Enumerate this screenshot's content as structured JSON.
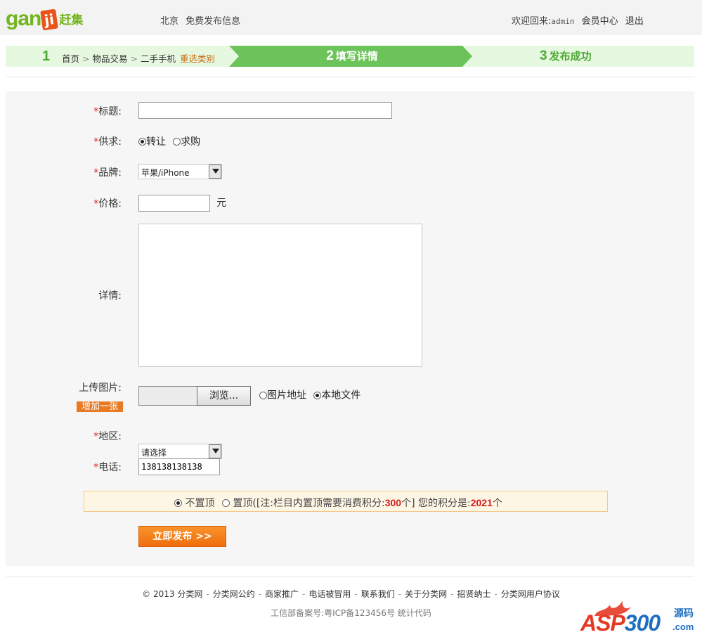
{
  "header": {
    "logo_latin": "gan",
    "logo_mark": "ji",
    "logo_cn": "赶集",
    "city": "北京",
    "post_free": "免费发布信息",
    "welcome": "欢迎回来:",
    "username": "admin",
    "member_center": "会员中心",
    "logout": "退出"
  },
  "steps": {
    "step1_num": "1",
    "crumbs": [
      "首页",
      "物品交易",
      "二手手机"
    ],
    "crumb_sep": ">",
    "reselect": "重选类别",
    "step2_num": "2",
    "step2_label": "填写详情",
    "step3_num": "3",
    "step3_label": "发布成功"
  },
  "form": {
    "required_mark": "*",
    "title_label": "标题:",
    "title_value": "",
    "supply_label": "供求:",
    "supply_options": [
      "转让",
      "求购"
    ],
    "supply_selected": "转让",
    "brand_label": "品牌:",
    "brand_value": "苹果/iPhone",
    "price_label": "价格:",
    "price_value": "",
    "price_unit": "元",
    "detail_label": "详情:",
    "detail_value": "",
    "upload_label": "上传图片:",
    "add_one": "增加一张",
    "browse": "浏览...",
    "upload_options": [
      "图片地址",
      "本地文件"
    ],
    "upload_selected": "本地文件",
    "area_label": "地区:",
    "area_value": "请选择",
    "phone_label": "电话:",
    "phone_value": "138138138138",
    "pin_off": "不置顶",
    "pin_on": "置顶",
    "pin_note_prefix": "([注:栏目内置顶需要消费积分:",
    "pin_cost": "300",
    "pin_note_mid": "个] 您的积分是:",
    "user_points": "2021",
    "pin_note_suffix": "个",
    "submit": "立即发布 >>"
  },
  "footer": {
    "links": [
      "© 2013 分类网",
      "分类网公约",
      "商家推广",
      "电话被冒用",
      "联系我们",
      "关于分类网",
      "招贤纳士",
      "分类网用户协议"
    ],
    "link_sep": "-",
    "icp": "工信部备案号:粤ICP备123456号",
    "stats": "统计代码"
  },
  "watermark": {
    "asp": "ASP",
    "num": "300",
    "cn": "源码",
    "com": ".com"
  },
  "colors": {
    "green": "#4ca933",
    "step_active": "#6cc35a",
    "step_bg": "#e7f8e1",
    "orange": "#ef6d0d",
    "required": "#e02020"
  }
}
